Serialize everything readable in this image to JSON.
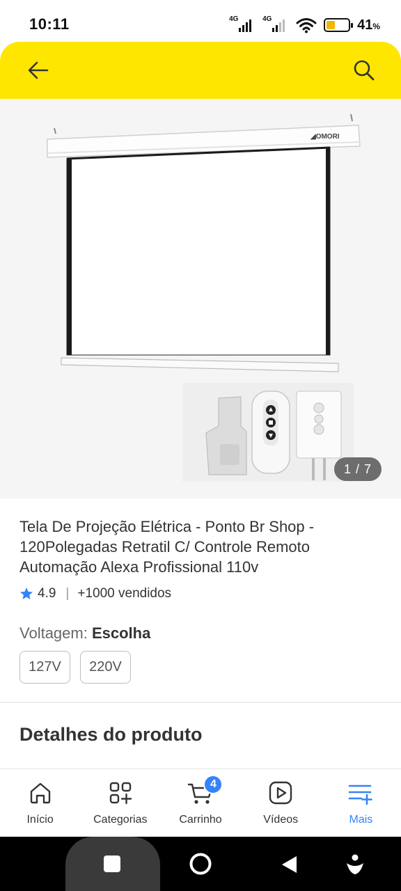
{
  "status_bar": {
    "time": "10:11",
    "network_1": "4G",
    "network_2": "4G",
    "battery_percent": "41",
    "battery_unit": "%",
    "battery_level": 0.41
  },
  "header": {
    "back_icon": "arrow-left-icon",
    "search_icon": "search-icon",
    "background_color": "#ffe600"
  },
  "gallery": {
    "brand_on_product": "OMORI",
    "counter": "1 / 7"
  },
  "product": {
    "title": "Tela De Projeção Elétrica - Ponto Br Shop - 120Polegadas Retratil C/ Controle Remoto Automação Alexa Profissional 110v",
    "rating": "4.9",
    "separator": "|",
    "sold": "+1000 vendidos"
  },
  "voltage": {
    "label": "Voltagem:",
    "value": "Escolha",
    "options": [
      "127V",
      "220V"
    ]
  },
  "details_heading": "Detalhes do produto",
  "bottom_nav": {
    "items": [
      {
        "label": "Início",
        "icon": "home-icon"
      },
      {
        "label": "Categorias",
        "icon": "categories-icon"
      },
      {
        "label": "Carrinho",
        "icon": "cart-icon",
        "badge": "4"
      },
      {
        "label": "Vídeos",
        "icon": "video-icon"
      },
      {
        "label": "Mais",
        "icon": "menu-plus-icon",
        "active": true
      }
    ],
    "active_color": "#3483fa"
  }
}
